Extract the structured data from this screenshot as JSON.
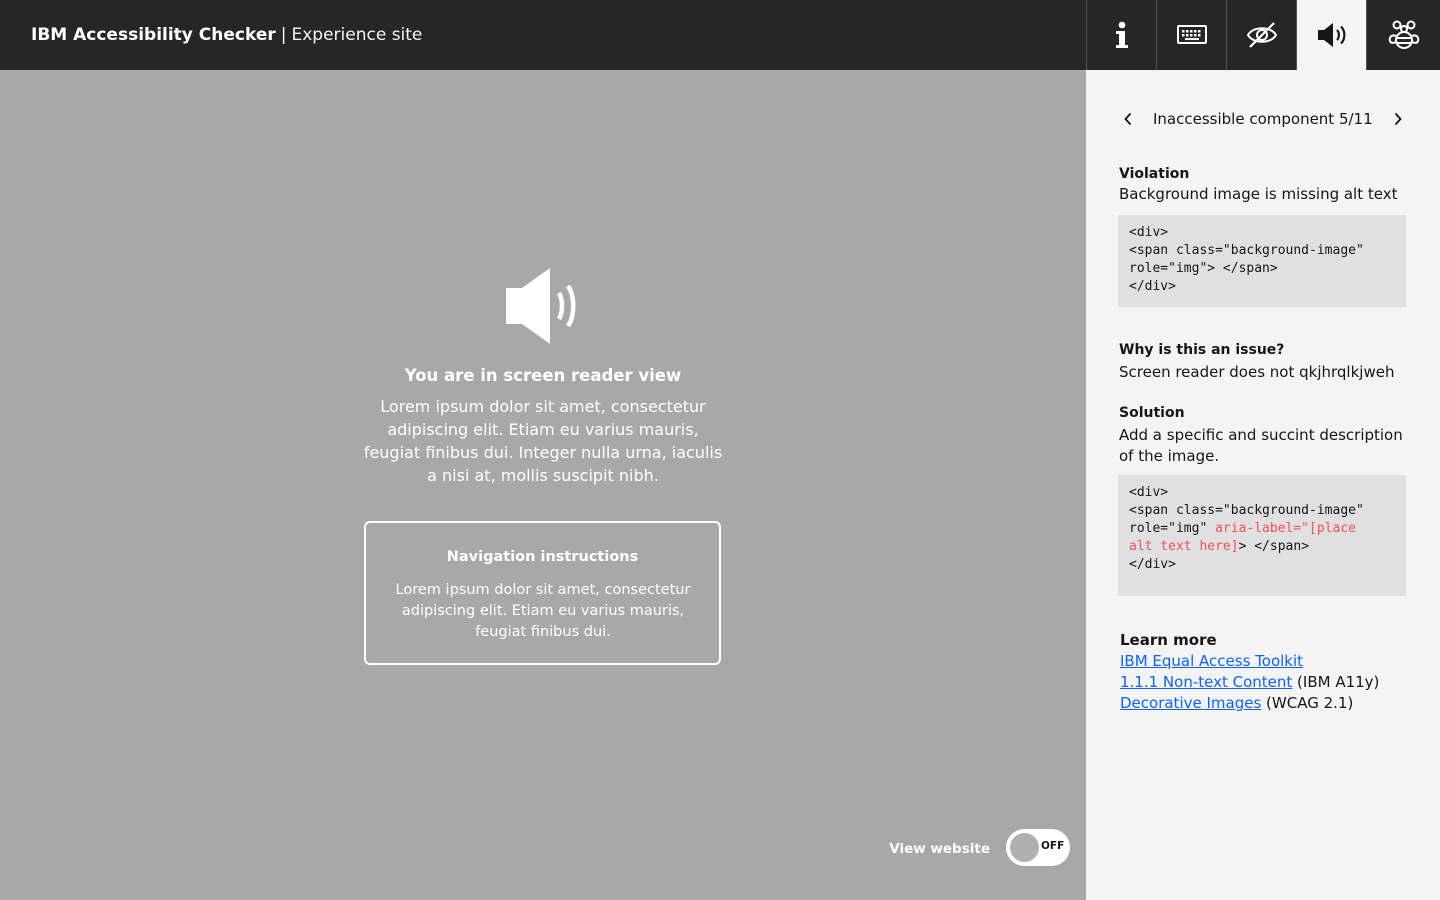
{
  "header": {
    "brand_bold": "IBM Accessibility Checker",
    "separator": "|",
    "brand_light": "Experience site",
    "tools": [
      {
        "icon": "info-icon",
        "active": false
      },
      {
        "icon": "keyboard-icon",
        "active": false
      },
      {
        "icon": "eye-slash-icon",
        "active": false
      },
      {
        "icon": "speaker-icon",
        "active": true
      },
      {
        "icon": "bee-icon",
        "active": false
      }
    ]
  },
  "main": {
    "hero_icon": "speaker-icon",
    "title": "You are in screen reader view",
    "body": "Lorem ipsum dolor sit amet, consectetur adipiscing elit. Etiam eu varius mauris, feugiat finibus dui. Integer nulla urna, iaculis a nisi at, mollis suscipit nibh.",
    "nav_title": "Navigation instructions",
    "nav_body": "Lorem ipsum dolor sit amet, consectetur adipiscing elit. Etiam eu varius mauris, feugiat finibus dui.",
    "view_label": "View website",
    "toggle_state": "OFF"
  },
  "panel": {
    "pager_label": "Inaccessible component 5/11",
    "violation_title": "Violation",
    "violation_text": "Background image is missing alt text",
    "violation_code": "<div>\n<span class=\"background-image\"\nrole=\"img\"> </span>\n</div>",
    "why_title": "Why is this an issue?",
    "why_text": "Screen reader does not qkjhrqlkjweh",
    "solution_title": "Solution",
    "solution_text": "Add a specific and succint description of the image.",
    "solution_code_pre": "<div>\n<span class=\"background-image\"\nrole=\"img\" ",
    "solution_code_highlight": "aria-label=\"[place\nalt text here]",
    "solution_code_post": "> </span>\n</div>",
    "learn_title": "Learn more",
    "links": [
      {
        "text": "IBM Equal Access Toolkit",
        "suffix": ""
      },
      {
        "text": "1.1.1 Non-text Content",
        "suffix": " (IBM A11y)"
      },
      {
        "text": "Decorative Images",
        "suffix": " (WCAG 2.1)"
      }
    ]
  },
  "colors": {
    "topbar": "#262626",
    "main_bg": "#a8a8a8",
    "panel_bg": "#f4f4f4",
    "code_bg": "#e0e0e0",
    "link": "#0f62fe",
    "code_highlight": "#fa4d56"
  }
}
